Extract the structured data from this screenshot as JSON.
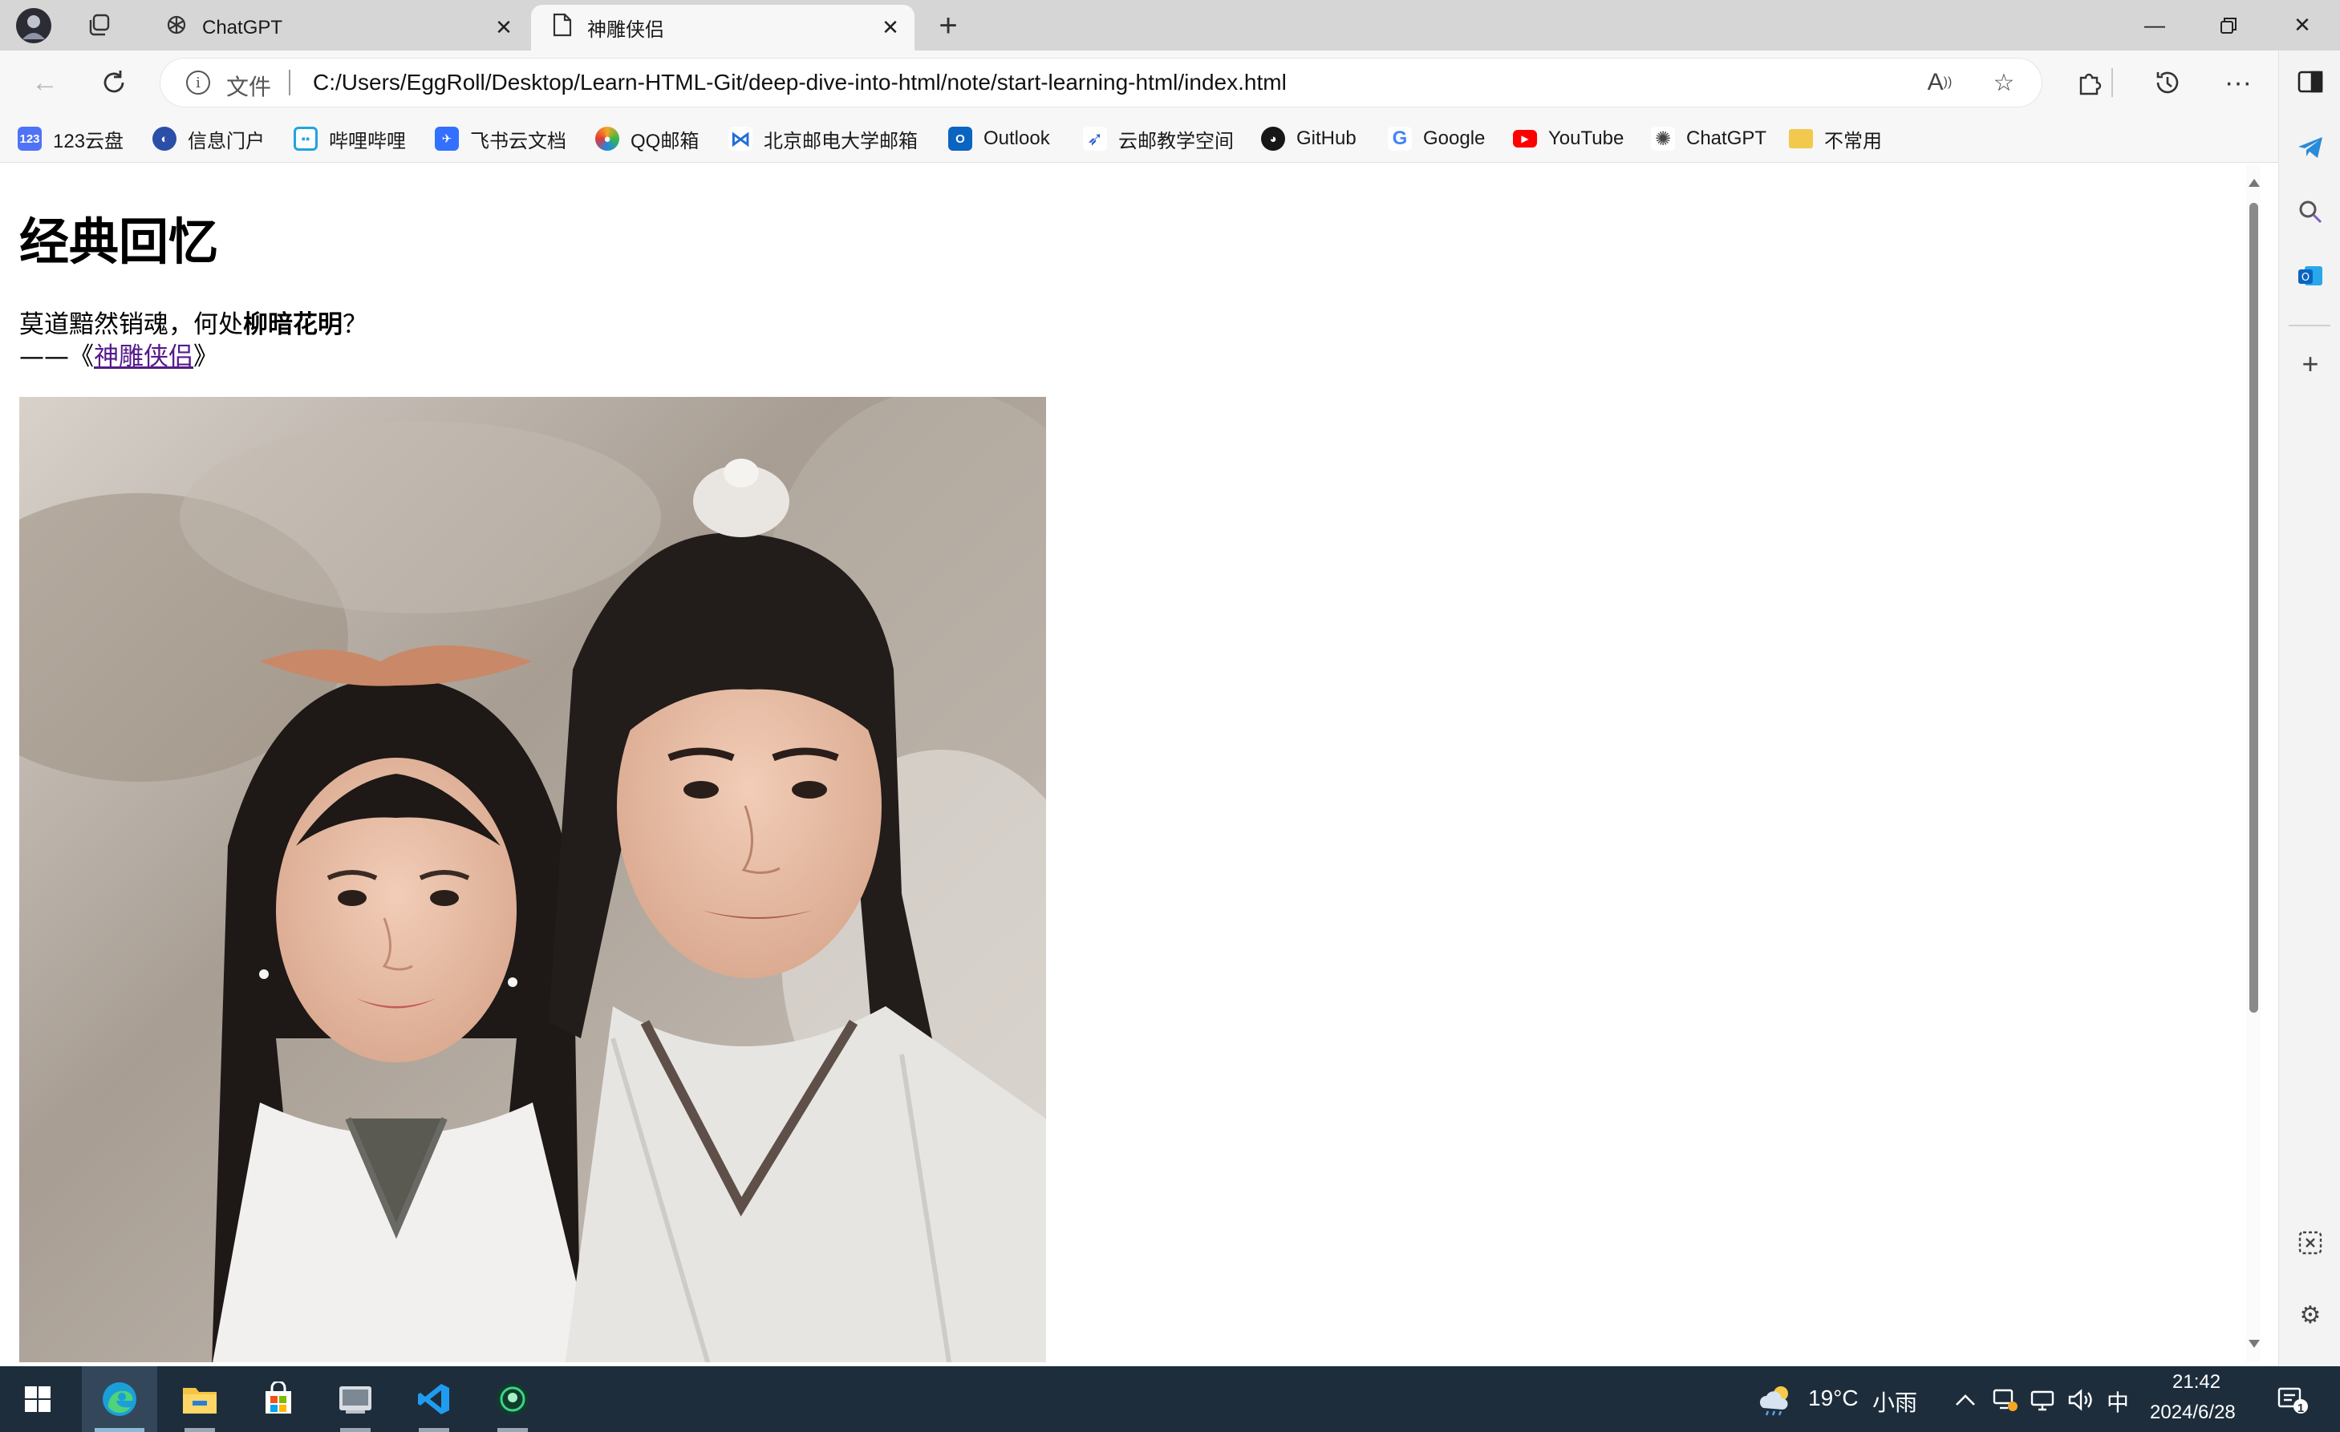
{
  "browser": {
    "tabs": [
      {
        "title": "ChatGPT",
        "icon": "chatgpt-icon",
        "active": false
      },
      {
        "title": "神雕侠侣",
        "icon": "page-icon",
        "active": true
      }
    ],
    "address": {
      "scheme_label": "文件",
      "url": "C:/Users/EggRoll/Desktop/Learn-HTML-Git/deep-dive-into-html/note/start-learning-html/index.html"
    },
    "bookmarks": [
      {
        "label": "123云盘",
        "color": "#3b6cf6"
      },
      {
        "label": "信息门户",
        "color": "#2b4fa8"
      },
      {
        "label": "哔哩哔哩",
        "color": "#21a4e0"
      },
      {
        "label": "飞书云文档",
        "color": "#3370ff"
      },
      {
        "label": "QQ邮箱",
        "color": "#f5a623"
      },
      {
        "label": "北京邮电大学邮箱",
        "color": "#1f6fd6"
      },
      {
        "label": "Outlook",
        "color": "#0a64c2"
      },
      {
        "label": "云邮教学空间",
        "color": "#2a5bd7"
      },
      {
        "label": "GitHub",
        "color": "#181717"
      },
      {
        "label": "Google",
        "color": "#4285f4"
      },
      {
        "label": "YouTube",
        "color": "#ff0000"
      },
      {
        "label": "ChatGPT",
        "color": "#444444"
      },
      {
        "label": "不常用",
        "color": "#f2c94c"
      }
    ]
  },
  "page": {
    "heading": "经典回忆",
    "quote_prefix": "莫道黯然销魂，何处",
    "quote_bold": "柳暗花明",
    "quote_suffix": "？",
    "source_prefix": "——《",
    "source_link": "神雕侠侣",
    "source_suffix": "》"
  },
  "taskbar": {
    "weather_temp": "19°C",
    "weather_desc": "小雨",
    "ime": "中",
    "time": "21:42",
    "date": "2024/6/28",
    "notification_count": "1"
  }
}
